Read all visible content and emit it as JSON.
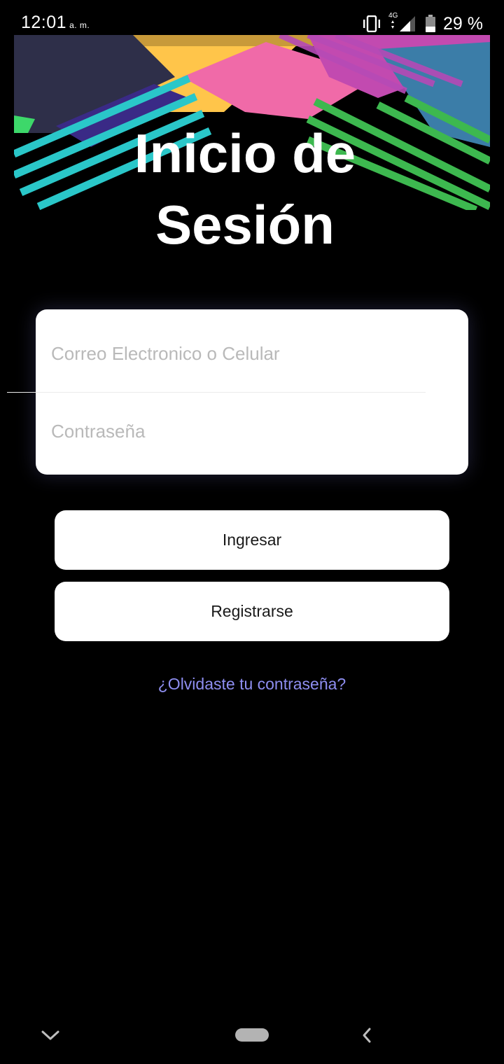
{
  "status_bar": {
    "time": "12:01",
    "ampm": "a. m.",
    "network": "4G",
    "battery_percent": "29 %"
  },
  "header": {
    "title_line1": "Inicio de",
    "title_line2": "Sesión"
  },
  "form": {
    "email_placeholder": "Correo Electronico o Celular",
    "email_value": "",
    "password_placeholder": "Contraseña",
    "password_value": ""
  },
  "buttons": {
    "login_label": "Ingresar",
    "register_label": "Registrarse"
  },
  "links": {
    "forgot_password": "¿Olvidaste tu contraseña?"
  },
  "colors": {
    "background": "#000000",
    "link": "#8e8ef0",
    "card": "#ffffff"
  }
}
